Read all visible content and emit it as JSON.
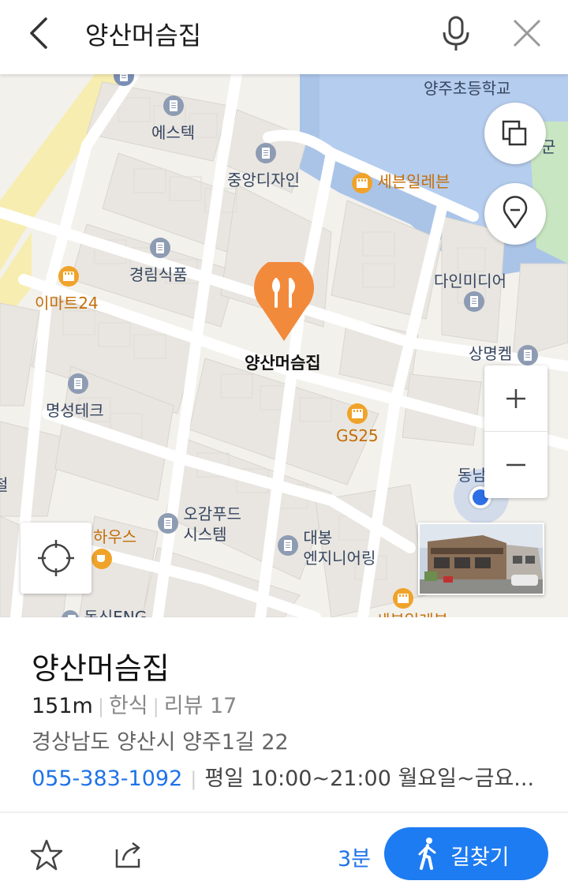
{
  "search": {
    "query": "양산머슴집"
  },
  "map": {
    "pois": {
      "yangju_elem": "양주초등학교",
      "estek": "에스텍",
      "jungang": "중앙디자인",
      "seven1": "세븐일레븐",
      "gyeongnim": "경림식품",
      "emart24": "이마트24",
      "dain": "다인미디어",
      "sangmyeong": "상명켐",
      "selected": "양산머슴집",
      "myeongseong": "명성테크",
      "gs25": "GS25",
      "dongnam": "동남",
      "ogam": "오감푸드\n시스템",
      "ogam1": "오감푸드",
      "ogam2": "시스템",
      "daebong1": "대봉",
      "daebong2": "엔지니어링",
      "house": "하우스",
      "dongsin": "동신ENG",
      "park_partial": "군",
      "left_partial": "철",
      "seven2_partial": "세븐일레븐"
    }
  },
  "place": {
    "name": "양산머슴집",
    "distance": "151m",
    "category": "한식",
    "review": "리뷰 17",
    "address": "경상남도 양산시 양주1길 22",
    "phone": "055-383-1092",
    "hours": "평일 10:00~21:00 월요일~금요..."
  },
  "actions": {
    "eta": "3분",
    "route_label": "길찾기"
  },
  "colors": {
    "accent": "#1e7cf2",
    "marker": "#f28a3c",
    "phone": "#1e73e8"
  }
}
